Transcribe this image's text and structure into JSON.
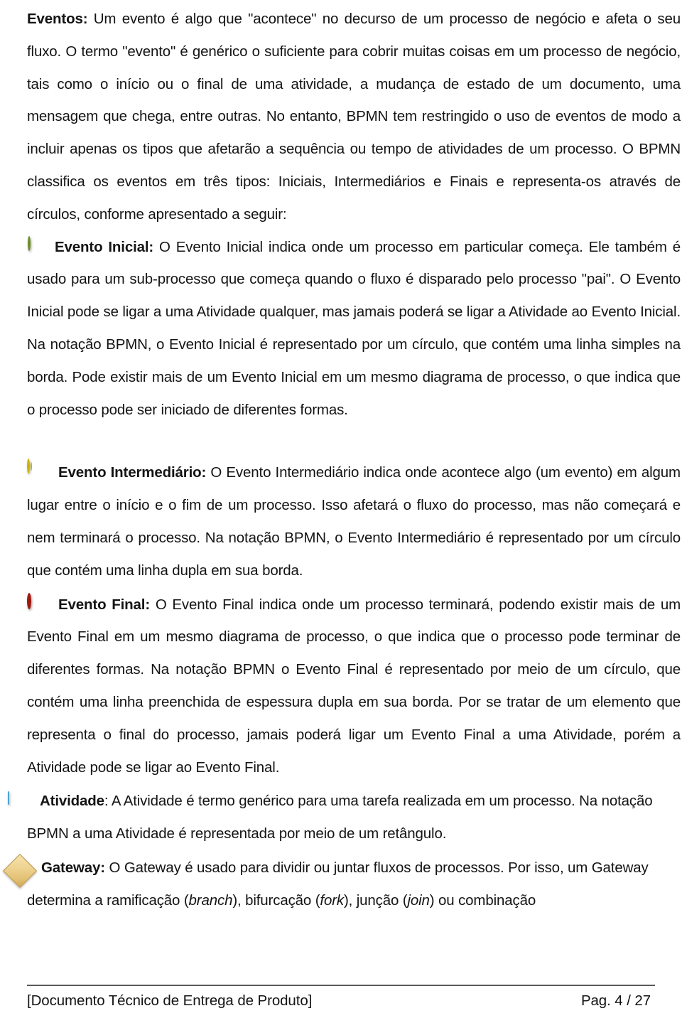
{
  "document": {
    "title_label": "Eventos:",
    "paragraphs": {
      "intro_bold": "Eventos:",
      "intro_rest": " Um evento é algo que \"acontece\" no decurso de um processo de negócio e afeta o seu fluxo. O termo \"evento\" é genérico o suficiente para cobrir muitas coisas em um processo de negócio, tais como o início ou o final de uma atividade, a mudança de estado de um documento, uma mensagem que chega, entre outras. No entanto, BPMN tem restringido o uso de eventos de modo a incluir apenas os tipos que afetarão a sequência ou tempo de atividades de um processo. O BPMN classifica os eventos em três tipos: Iniciais, Intermediários e Finais e representa-os através de círculos, conforme apresentado a seguir:",
      "start_event_bold": "Evento Inicial:",
      "start_event_rest": " O Evento Inicial indica onde um processo em particular começa. Ele também é usado para um sub-processo que começa quando o fluxo é disparado pelo processo \"pai\". O Evento Inicial pode se ligar a uma Atividade qualquer, mas jamais poderá se ligar a Atividade ao Evento Inicial. Na notação BPMN, o Evento Inicial é representado por um círculo, que contém uma linha simples na borda. Pode existir mais de um Evento Inicial em um mesmo diagrama de processo, o que indica que o processo pode ser iniciado de diferentes formas.",
      "intermediate_event_bold": "Evento Intermediário:",
      "intermediate_event_rest": " O Evento Intermediário indica onde acontece algo (um evento) em algum lugar entre o início e o fim de um processo. Isso afetará o fluxo do processo, mas não começará e nem terminará o processo. Na notação BPMN, o Evento Intermediário é representado por um círculo que contém uma linha dupla em sua borda.",
      "end_event_bold": "Evento Final:",
      "end_event_rest": " O Evento Final indica onde um processo terminará, podendo existir mais de um Evento Final em um mesmo diagrama de processo, o que indica que o processo pode terminar de diferentes formas. Na notação BPMN o Evento Final é representado por meio de um círculo, que contém uma linha preenchida de espessura dupla em sua borda. Por se tratar de um elemento que representa o final do processo, jamais poderá ligar um Evento Final a uma Atividade, porém a Atividade pode se ligar ao Evento Final.",
      "activity_bold": "Atividade",
      "activity_rest": ": A Atividade é termo genérico para uma tarefa realizada em um processo. Na notação BPMN a uma Atividade é representada por meio de um retângulo.",
      "gateway_bold": "Gateway:",
      "gateway_part1": " O Gateway é usado para dividir ou juntar fluxos de processos. Por isso, um Gateway determina a ramificação (",
      "gateway_italic1": "branch",
      "gateway_part2": "), bifurcação (",
      "gateway_italic2": "fork",
      "gateway_part3": "), junção (",
      "gateway_italic3": "join",
      "gateway_part4": ") ou combinação"
    },
    "icons": {
      "start_event": "green-circle-start-event-icon",
      "intermediate_event": "yellow-double-circle-intermediate-event-icon",
      "end_event": "red-circle-end-event-icon",
      "activity": "blue-rounded-rectangle-activity-icon",
      "gateway": "gold-diamond-gateway-icon"
    },
    "colors": {
      "start_event": "#8cc63f",
      "intermediate_event": "#f8ec4e",
      "end_event": "#ec3a2c",
      "activity": "#a9daf2",
      "gateway": "#eed492",
      "text": "#141414",
      "footer_rule": "#595959"
    }
  },
  "footer": {
    "left_text": "[Documento Técnico de Entrega de Produto]",
    "right_text": "Pag. 4 / 27"
  }
}
